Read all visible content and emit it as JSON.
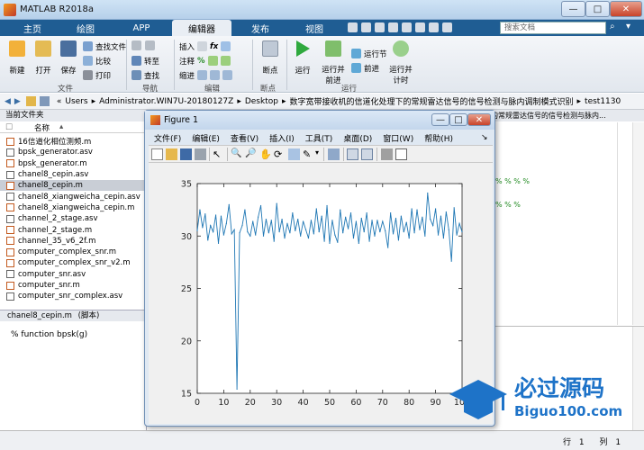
{
  "app": {
    "title": "MATLAB R2018a"
  },
  "window_controls": {
    "minimize": "—",
    "maximize": "□",
    "close": "✕"
  },
  "ribbon_tabs": [
    "主页",
    "绘图",
    "APP",
    "编辑器",
    "发布",
    "视图"
  ],
  "search": {
    "placeholder": "搜索文档"
  },
  "ribbon": {
    "file": {
      "new": "新建",
      "open": "打开",
      "save": "保存",
      "find_files": "查找文件",
      "compare": "比较",
      "print": "打印",
      "label": "文件"
    },
    "nav": {
      "goto": "转至",
      "find": "查找",
      "label": "导航"
    },
    "edit": {
      "insert": "插入",
      "comment": "注释",
      "indent": "缩进",
      "label": "编辑"
    },
    "breakpoints": {
      "btn": "断点",
      "label": "断点"
    },
    "run": {
      "run": "运行",
      "run_advance_1": "运行并",
      "run_advance_2": "前进",
      "run_section": "运行节",
      "advance": "前进",
      "run_time_1": "运行并",
      "run_time_2": "计时",
      "label": "运行"
    }
  },
  "address": {
    "crumbs": [
      "Users",
      "Administrator.WIN7U-20180127Z",
      "Desktop",
      "数字宽带接收机的信道化处理下的常规雷达信号的信号检测与脉内调制模式识别",
      "test1130"
    ]
  },
  "current_folder": {
    "title": "当前文件夹",
    "column": "名称",
    "files": [
      "16信道化相位测频.m",
      "bpsk_generator.asv",
      "bpsk_generator.m",
      "chanel8_cepin.asv",
      "chanel8_cepin.m",
      "chanel8_xiangweicha_cepin.asv",
      "chanel8_xiangweicha_cepin.m",
      "channel_2_stage.asv",
      "channel_2_stage.m",
      "channel_35_v6_2f.m",
      "computer_complex_snr.m",
      "computer_complex_snr_v2.m",
      "computer_snr.asv",
      "computer_snr.m",
      "computer_snr_complex.asv"
    ],
    "selected_index": 4
  },
  "details": {
    "filename": "chanel8_cepin.m",
    "type": "(脚本)",
    "code": "% function bpsk(g)"
  },
  "editor": {
    "snippet": "的常规雷达信号的信号检测与脉内...",
    "line1": "% % % %",
    "line2": "% % %"
  },
  "status": {
    "row_label": "行",
    "row": "1",
    "col_label": "列",
    "col": "1"
  },
  "figure": {
    "title": "Figure 1",
    "menu": [
      "文件(F)",
      "编辑(E)",
      "查看(V)",
      "插入(I)",
      "工具(T)",
      "桌面(D)",
      "窗口(W)",
      "帮助(H)"
    ]
  },
  "watermark": {
    "brand": "必过源码",
    "url": "Biguo100.com"
  },
  "chart_data": {
    "type": "line",
    "title": "",
    "xlabel": "",
    "ylabel": "",
    "xlim": [
      0,
      100
    ],
    "ylim": [
      15,
      35
    ],
    "xticks": [
      0,
      10,
      20,
      30,
      40,
      50,
      60,
      70,
      80,
      90,
      100
    ],
    "yticks": [
      15,
      20,
      25,
      30,
      35
    ],
    "color": "#1f77b4",
    "grid": false,
    "y": [
      30.5,
      32.5,
      30.8,
      32.1,
      29.6,
      31.0,
      30.4,
      32.0,
      29.3,
      31.9,
      30.1,
      31.2,
      33.0,
      30.2,
      30.6,
      15.4,
      30.3,
      31.0,
      32.5,
      30.4,
      30.0,
      31.4,
      30.1,
      31.8,
      32.9,
      30.0,
      31.6,
      30.3,
      31.5,
      29.5,
      33.1,
      30.4,
      31.6,
      29.8,
      31.2,
      30.3,
      32.2,
      30.5,
      31.6,
      30.0,
      31.4,
      30.6,
      29.8,
      31.5,
      30.2,
      32.6,
      30.4,
      31.9,
      29.5,
      32.9,
      29.3,
      31.5,
      30.1,
      29.4,
      32.5,
      30.3,
      31.8,
      30.7,
      32.2,
      29.8,
      31.4,
      29.3,
      31.7,
      30.4,
      32.2,
      29.5,
      31.5,
      30.0,
      31.5,
      30.4,
      31.4,
      30.5,
      28.9,
      32.2,
      30.2,
      31.7,
      29.6,
      31.9,
      30.4,
      31.3,
      29.8,
      32.6,
      30.3,
      32.5,
      30.6,
      31.8,
      30.0,
      34.1,
      31.6,
      31.0,
      32.6,
      30.1,
      31.9,
      29.8,
      32.3,
      30.6,
      27.6,
      32.7,
      30.1,
      31.2,
      30.4
    ]
  }
}
